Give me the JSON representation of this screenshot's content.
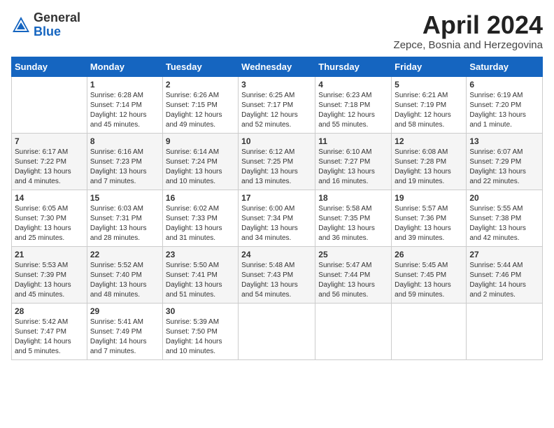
{
  "logo": {
    "general": "General",
    "blue": "Blue"
  },
  "title": "April 2024",
  "subtitle": "Zepce, Bosnia and Herzegovina",
  "days_of_week": [
    "Sunday",
    "Monday",
    "Tuesday",
    "Wednesday",
    "Thursday",
    "Friday",
    "Saturday"
  ],
  "weeks": [
    [
      {
        "day": "",
        "info": ""
      },
      {
        "day": "1",
        "info": "Sunrise: 6:28 AM\nSunset: 7:14 PM\nDaylight: 12 hours\nand 45 minutes."
      },
      {
        "day": "2",
        "info": "Sunrise: 6:26 AM\nSunset: 7:15 PM\nDaylight: 12 hours\nand 49 minutes."
      },
      {
        "day": "3",
        "info": "Sunrise: 6:25 AM\nSunset: 7:17 PM\nDaylight: 12 hours\nand 52 minutes."
      },
      {
        "day": "4",
        "info": "Sunrise: 6:23 AM\nSunset: 7:18 PM\nDaylight: 12 hours\nand 55 minutes."
      },
      {
        "day": "5",
        "info": "Sunrise: 6:21 AM\nSunset: 7:19 PM\nDaylight: 12 hours\nand 58 minutes."
      },
      {
        "day": "6",
        "info": "Sunrise: 6:19 AM\nSunset: 7:20 PM\nDaylight: 13 hours\nand 1 minute."
      }
    ],
    [
      {
        "day": "7",
        "info": "Sunrise: 6:17 AM\nSunset: 7:22 PM\nDaylight: 13 hours\nand 4 minutes."
      },
      {
        "day": "8",
        "info": "Sunrise: 6:16 AM\nSunset: 7:23 PM\nDaylight: 13 hours\nand 7 minutes."
      },
      {
        "day": "9",
        "info": "Sunrise: 6:14 AM\nSunset: 7:24 PM\nDaylight: 13 hours\nand 10 minutes."
      },
      {
        "day": "10",
        "info": "Sunrise: 6:12 AM\nSunset: 7:25 PM\nDaylight: 13 hours\nand 13 minutes."
      },
      {
        "day": "11",
        "info": "Sunrise: 6:10 AM\nSunset: 7:27 PM\nDaylight: 13 hours\nand 16 minutes."
      },
      {
        "day": "12",
        "info": "Sunrise: 6:08 AM\nSunset: 7:28 PM\nDaylight: 13 hours\nand 19 minutes."
      },
      {
        "day": "13",
        "info": "Sunrise: 6:07 AM\nSunset: 7:29 PM\nDaylight: 13 hours\nand 22 minutes."
      }
    ],
    [
      {
        "day": "14",
        "info": "Sunrise: 6:05 AM\nSunset: 7:30 PM\nDaylight: 13 hours\nand 25 minutes."
      },
      {
        "day": "15",
        "info": "Sunrise: 6:03 AM\nSunset: 7:31 PM\nDaylight: 13 hours\nand 28 minutes."
      },
      {
        "day": "16",
        "info": "Sunrise: 6:02 AM\nSunset: 7:33 PM\nDaylight: 13 hours\nand 31 minutes."
      },
      {
        "day": "17",
        "info": "Sunrise: 6:00 AM\nSunset: 7:34 PM\nDaylight: 13 hours\nand 34 minutes."
      },
      {
        "day": "18",
        "info": "Sunrise: 5:58 AM\nSunset: 7:35 PM\nDaylight: 13 hours\nand 36 minutes."
      },
      {
        "day": "19",
        "info": "Sunrise: 5:57 AM\nSunset: 7:36 PM\nDaylight: 13 hours\nand 39 minutes."
      },
      {
        "day": "20",
        "info": "Sunrise: 5:55 AM\nSunset: 7:38 PM\nDaylight: 13 hours\nand 42 minutes."
      }
    ],
    [
      {
        "day": "21",
        "info": "Sunrise: 5:53 AM\nSunset: 7:39 PM\nDaylight: 13 hours\nand 45 minutes."
      },
      {
        "day": "22",
        "info": "Sunrise: 5:52 AM\nSunset: 7:40 PM\nDaylight: 13 hours\nand 48 minutes."
      },
      {
        "day": "23",
        "info": "Sunrise: 5:50 AM\nSunset: 7:41 PM\nDaylight: 13 hours\nand 51 minutes."
      },
      {
        "day": "24",
        "info": "Sunrise: 5:48 AM\nSunset: 7:43 PM\nDaylight: 13 hours\nand 54 minutes."
      },
      {
        "day": "25",
        "info": "Sunrise: 5:47 AM\nSunset: 7:44 PM\nDaylight: 13 hours\nand 56 minutes."
      },
      {
        "day": "26",
        "info": "Sunrise: 5:45 AM\nSunset: 7:45 PM\nDaylight: 13 hours\nand 59 minutes."
      },
      {
        "day": "27",
        "info": "Sunrise: 5:44 AM\nSunset: 7:46 PM\nDaylight: 14 hours\nand 2 minutes."
      }
    ],
    [
      {
        "day": "28",
        "info": "Sunrise: 5:42 AM\nSunset: 7:47 PM\nDaylight: 14 hours\nand 5 minutes."
      },
      {
        "day": "29",
        "info": "Sunrise: 5:41 AM\nSunset: 7:49 PM\nDaylight: 14 hours\nand 7 minutes."
      },
      {
        "day": "30",
        "info": "Sunrise: 5:39 AM\nSunset: 7:50 PM\nDaylight: 14 hours\nand 10 minutes."
      },
      {
        "day": "",
        "info": ""
      },
      {
        "day": "",
        "info": ""
      },
      {
        "day": "",
        "info": ""
      },
      {
        "day": "",
        "info": ""
      }
    ]
  ]
}
